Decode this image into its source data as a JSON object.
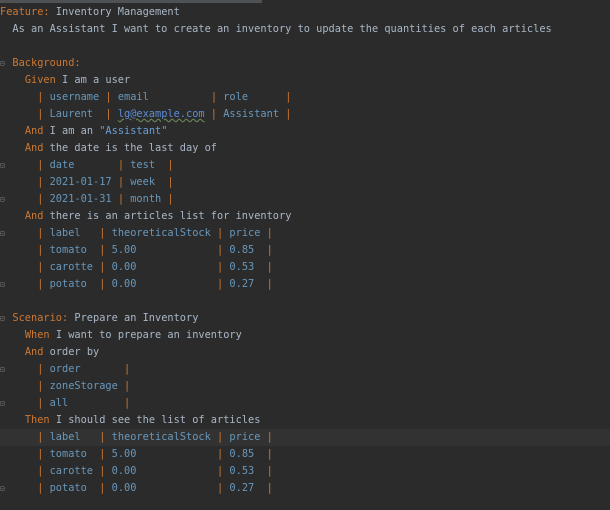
{
  "feature": {
    "keyword": "Feature:",
    "title": " Inventory Management",
    "description": "  As an Assistant I want to create an inventory to update the quantities of each articles"
  },
  "background": {
    "keyword": "Background:",
    "given_kw": "Given",
    "given_text": " I am a user",
    "users_header": [
      "username ",
      "email          ",
      "role      "
    ],
    "users_row": [
      "Laurent  ",
      "lg@example.com",
      "Assistant "
    ],
    "and1_kw": "And",
    "and1_text": " I am an ",
    "and1_str": "\"Assistant\"",
    "and2_kw": "And",
    "and2_text": " the date is the last day of",
    "dates_header": [
      "date       ",
      "test  "
    ],
    "dates_rows": [
      [
        "2021-01-17 ",
        "week  "
      ],
      [
        "2021-01-31 ",
        "month "
      ]
    ],
    "and3_kw": "And",
    "and3_text": " there is an articles list for inventory",
    "articles_header": [
      "label   ",
      "theoreticalStock ",
      "price "
    ],
    "articles_rows": [
      [
        "tomato  ",
        "5.00             ",
        "0.85  "
      ],
      [
        "carotte ",
        "0.00             ",
        "0.53  "
      ],
      [
        "potato  ",
        "0.00             ",
        "0.27  "
      ]
    ]
  },
  "scenario": {
    "keyword": "Scenario:",
    "title": " Prepare an Inventory",
    "when_kw": "When",
    "when_text": " I want to prepare an inventory",
    "and_kw": "And",
    "and_text": " order by",
    "order_rows": [
      "order       ",
      "zoneStorage ",
      "all         "
    ],
    "then_kw": "Then",
    "then_text": " I should see the list of articles",
    "result_header": [
      "label   ",
      "theoreticalStock ",
      "price "
    ],
    "result_rows": [
      [
        "tomato  ",
        "5.00             ",
        "0.85  "
      ],
      [
        "carotte ",
        "0.00             ",
        "0.53  "
      ],
      [
        "potato  ",
        "0.00             ",
        "0.27  "
      ]
    ]
  },
  "colors": {
    "background": "#2b2b2b",
    "keyword": "#cc7832",
    "table_value": "#6897bb",
    "text": "#a9b7c6",
    "current_line": "#323232"
  }
}
